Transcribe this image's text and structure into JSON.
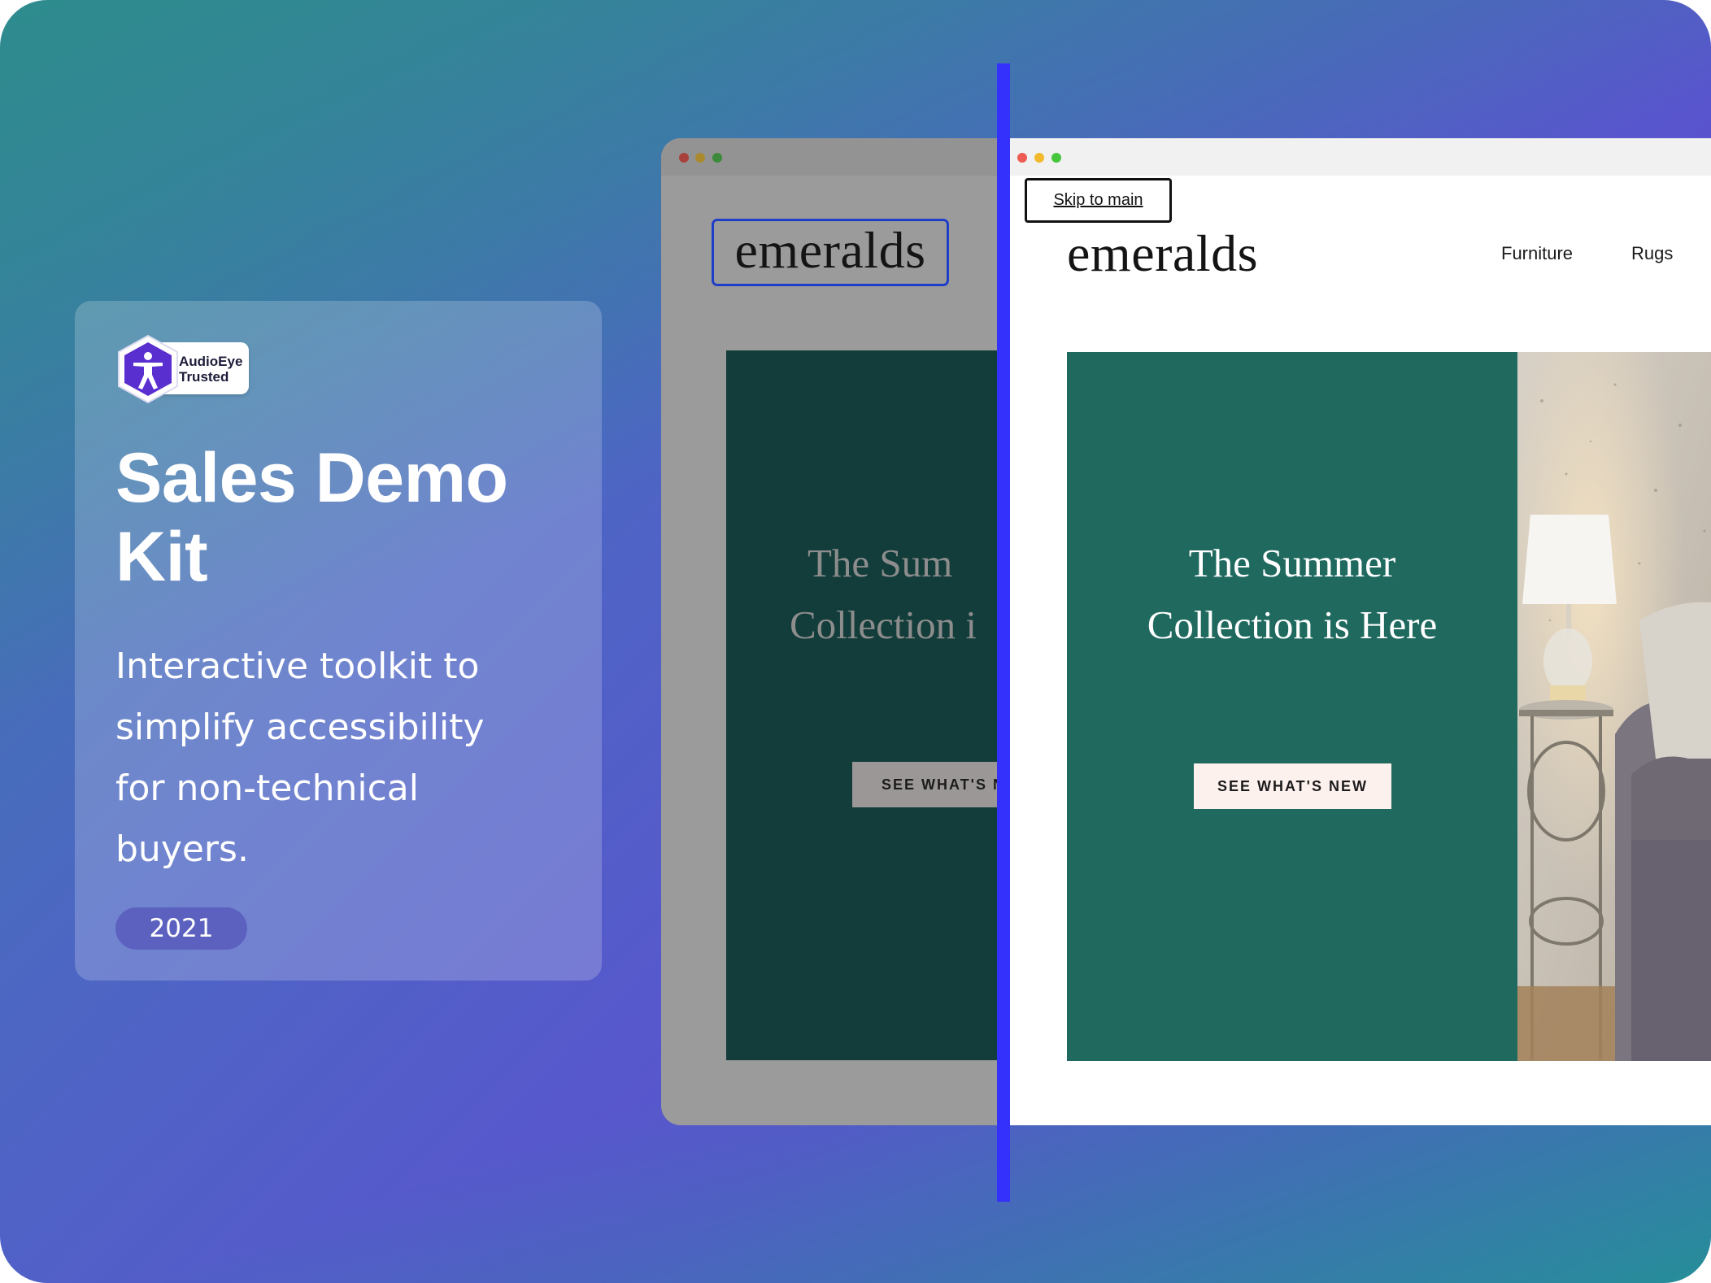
{
  "badge": {
    "line1": "AudioEye",
    "line2": "Trusted"
  },
  "card": {
    "title_line1": "Sales Demo",
    "title_line2": "Kit",
    "description_lines": [
      "Interactive toolkit to",
      "simplify accessibility",
      "for non-technical",
      "buyers."
    ],
    "year": "2021"
  },
  "before_view": {
    "logo": "emeralds",
    "hero_line1": "The Sum",
    "hero_line2": "Collection i",
    "cta": "SEE WHAT'S N"
  },
  "after_view": {
    "skip_link": "Skip to main",
    "logo": "emeralds",
    "nav": [
      "Furniture",
      "Rugs"
    ],
    "hero_line1": "The Summer",
    "hero_line2": "Collection is Here",
    "cta": "SEE WHAT'S NEW"
  },
  "colors": {
    "divider": "#3331fb",
    "focus_outline": "#1f3ec8",
    "hero_after": "#1f695f",
    "hero_before": "#123d3a",
    "badge_hex": "#5a2fd0"
  }
}
